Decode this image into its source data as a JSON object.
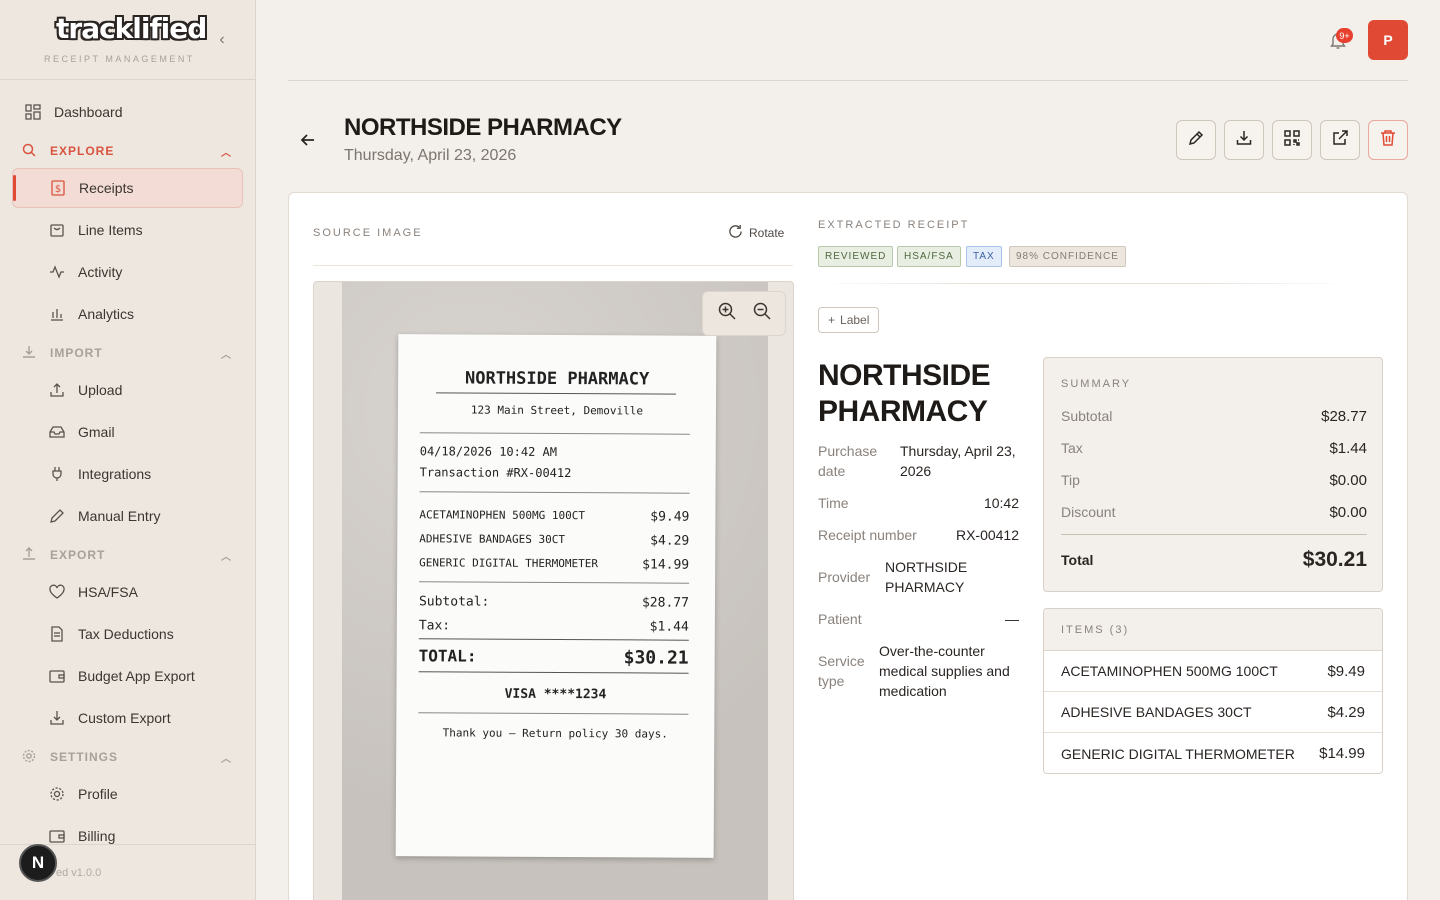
{
  "app": {
    "logo_text": "tracklified",
    "subtitle": "RECEIPT MANAGEMENT",
    "version": "ed v1.0.0",
    "bottom_badge": "N"
  },
  "sidebar": {
    "dashboard": "Dashboard",
    "sections": {
      "explore": "EXPLORE",
      "import": "IMPORT",
      "export": "EXPORT",
      "settings": "SETTINGS"
    },
    "explore_items": [
      "Receipts",
      "Line Items",
      "Activity",
      "Analytics"
    ],
    "import_items": [
      "Upload",
      "Gmail",
      "Integrations",
      "Manual Entry"
    ],
    "export_items": [
      "HSA/FSA",
      "Tax Deductions",
      "Budget App Export",
      "Custom Export"
    ],
    "settings_items": [
      "Profile",
      "Billing"
    ]
  },
  "topbar": {
    "notification_count": "9+",
    "avatar_initial": "P"
  },
  "header": {
    "title": "NORTHSIDE PHARMACY",
    "date": "Thursday, April 23, 2026"
  },
  "source": {
    "label": "SOURCE IMAGE",
    "rotate": "Rotate"
  },
  "receipt_image": {
    "store": "NORTHSIDE PHARMACY",
    "address": "123 Main Street, Demoville",
    "datetime": "04/18/2026 10:42 AM",
    "transaction": "Transaction #RX-00412",
    "items": [
      {
        "name": "ACETAMINOPHEN 500MG 100CT",
        "price": "$9.49"
      },
      {
        "name": "ADHESIVE BANDAGES 30CT",
        "price": "$4.29"
      },
      {
        "name": "GENERIC DIGITAL THERMOMETER",
        "price": "$14.99"
      }
    ],
    "subtotal_label": "Subtotal:",
    "subtotal": "$28.77",
    "tax_label": "Tax:",
    "tax": "$1.44",
    "total_label": "TOTAL:",
    "total": "$30.21",
    "card": "VISA ****1234",
    "footer": "Thank you — Return policy 30 days."
  },
  "extracted": {
    "label": "EXTRACTED RECEIPT",
    "chips": [
      "REVIEWED",
      "HSA/FSA",
      "TAX",
      "98% CONFIDENCE"
    ],
    "add_label": "Label",
    "merchant": "NORTHSIDE PHARMACY",
    "fields": {
      "purchase_date_label": "Purchase date",
      "purchase_date": "Thursday, April 23, 2026",
      "time_label": "Time",
      "time": "10:42",
      "receipt_number_label": "Receipt number",
      "receipt_number": "RX-00412",
      "provider_label": "Provider",
      "provider": "NORTHSIDE PHARMACY",
      "patient_label": "Patient",
      "patient": "—",
      "service_type_label": "Service type",
      "service_type": "Over-the-counter medical supplies and medication"
    },
    "summary": {
      "label": "SUMMARY",
      "subtotal_label": "Subtotal",
      "subtotal": "$28.77",
      "tax_label": "Tax",
      "tax": "$1.44",
      "tip_label": "Tip",
      "tip": "$0.00",
      "discount_label": "Discount",
      "discount": "$0.00",
      "total_label": "Total",
      "total": "$30.21"
    },
    "items_label": "ITEMS (3)",
    "items": [
      {
        "name": "ACETAMINOPHEN 500MG 100CT",
        "amount": "$9.49"
      },
      {
        "name": "ADHESIVE BANDAGES 30CT",
        "amount": "$4.29"
      },
      {
        "name": "GENERIC DIGITAL THERMOMETER",
        "amount": "$14.99"
      }
    ]
  },
  "colors": {
    "accent": "#e04a35",
    "background": "#f3efea"
  }
}
